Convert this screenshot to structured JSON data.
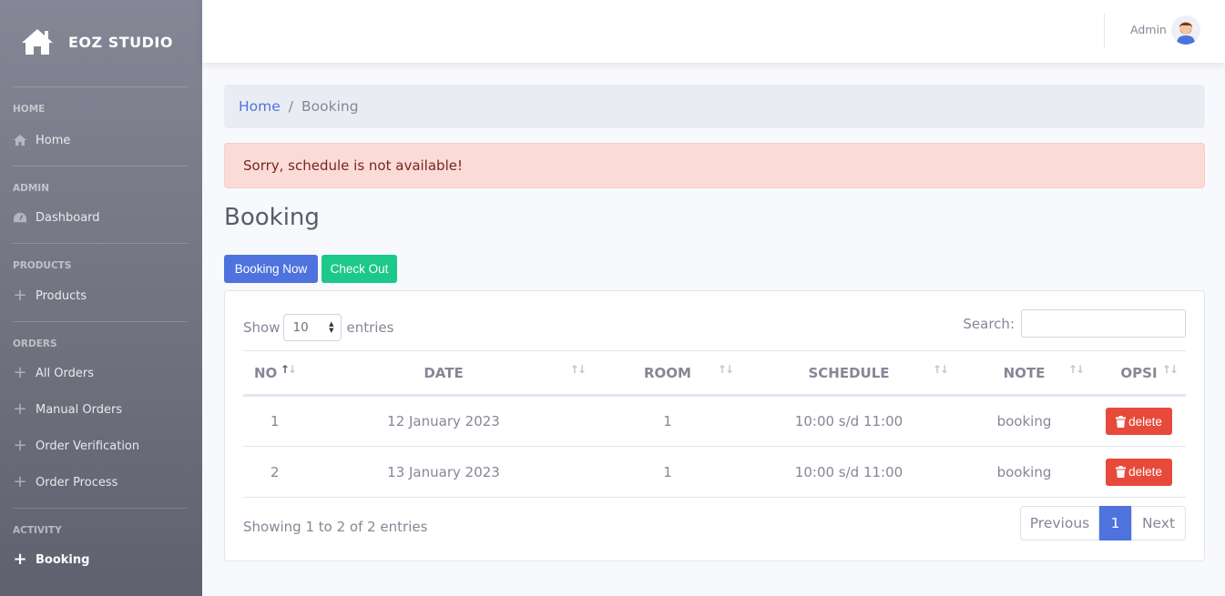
{
  "brand": {
    "name": "EOZ STUDIO",
    "icon": "home-icon"
  },
  "sidebar": {
    "sections": [
      {
        "heading": "HOME",
        "items": [
          {
            "label": "Home",
            "icon": "home-icon"
          }
        ]
      },
      {
        "heading": "ADMIN",
        "items": [
          {
            "label": "Dashboard",
            "icon": "tachometer-icon"
          }
        ]
      },
      {
        "heading": "PRODUCTS",
        "items": [
          {
            "label": "Products",
            "icon": "plus-icon"
          }
        ]
      },
      {
        "heading": "ORDERS",
        "items": [
          {
            "label": "All Orders",
            "icon": "plus-icon"
          },
          {
            "label": "Manual Orders",
            "icon": "plus-icon"
          },
          {
            "label": "Order Verification",
            "icon": "plus-icon"
          },
          {
            "label": "Order Process",
            "icon": "plus-icon"
          }
        ]
      },
      {
        "heading": "ACTIVITY",
        "items": [
          {
            "label": "Booking",
            "icon": "plus-icon",
            "active": true
          }
        ]
      }
    ]
  },
  "topbar": {
    "user_name": "Admin"
  },
  "breadcrumb": {
    "home": "Home",
    "separator": "/",
    "current": "Booking"
  },
  "alert": {
    "message": "Sorry, schedule is not available!"
  },
  "page": {
    "title": "Booking"
  },
  "actions": {
    "booking_now": "Booking Now",
    "check_out": "Check Out"
  },
  "datatable": {
    "show_label": "Show",
    "entries_label": "entries",
    "page_length": "10",
    "search_label": "Search:",
    "search_value": "",
    "columns": [
      "NO",
      "DATE",
      "ROOM",
      "SCHEDULE",
      "NOTE",
      "OPSI"
    ],
    "rows": [
      {
        "no": "1",
        "date": "12 January 2023",
        "room": "1",
        "schedule": "10:00 s/d 11:00",
        "note": "booking",
        "action": "delete"
      },
      {
        "no": "2",
        "date": "13 January 2023",
        "room": "1",
        "schedule": "10:00 s/d 11:00",
        "note": "booking",
        "action": "delete"
      }
    ],
    "info": "Showing 1 to 2 of 2 entries",
    "pagination": {
      "previous": "Previous",
      "current": "1",
      "next": "Next"
    }
  },
  "colors": {
    "primary": "#4e73df",
    "success": "#1cc88a",
    "danger": "#e74a3b",
    "alert_bg": "#fadbd8"
  }
}
